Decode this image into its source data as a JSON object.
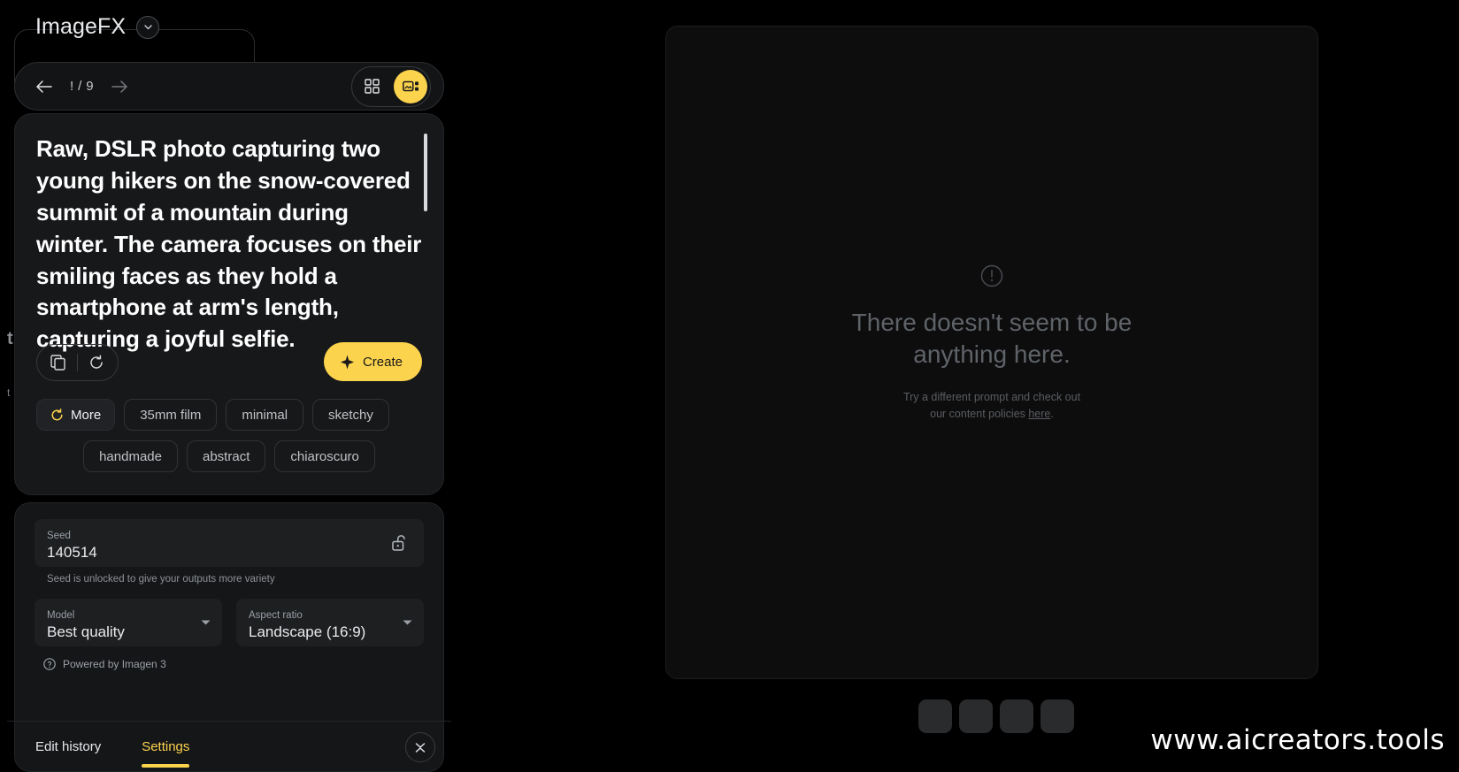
{
  "app": {
    "title": "ImageFX",
    "caret_icon": "chevron-down-icon"
  },
  "nav": {
    "back_icon": "arrow-left-icon",
    "forward_icon": "arrow-right-icon",
    "counter": "! / 9",
    "grid_view_icon": "grid-view-icon",
    "detail_view_icon": "detail-view-icon"
  },
  "prompt": {
    "text": "Raw, DSLR photo capturing two young hikers on the snow-covered summit of a mountain during winter. The camera focuses on their smiling faces as they hold a smartphone at arm's length, capturing a joyful selfie.",
    "copy_icon": "copy-icon",
    "refresh_icon": "refresh-icon",
    "create_label": "Create",
    "create_icon": "sparkle-icon"
  },
  "chips": {
    "more_label": "More",
    "more_icon": "refresh-cw-icon",
    "row1": [
      "35mm film",
      "minimal",
      "sketchy"
    ],
    "row2": [
      "handmade",
      "abstract",
      "chiaroscuro"
    ]
  },
  "settings": {
    "seed": {
      "label": "Seed",
      "value": "140514",
      "lock_icon": "unlock-icon",
      "helper": "Seed is unlocked to give your outputs more variety"
    },
    "model": {
      "label": "Model",
      "value": "Best quality",
      "caret_icon": "chevron-down-icon"
    },
    "aspect_ratio": {
      "label": "Aspect ratio",
      "value": "Landscape (16:9)",
      "caret_icon": "chevron-down-icon"
    },
    "powered_by": "Powered by Imagen 3",
    "powered_icon": "help-circle-icon"
  },
  "tabs": {
    "edit_history": "Edit history",
    "settings": "Settings",
    "active": "Settings",
    "collapse_icon": "collapse-chevrons-icon"
  },
  "ghost": {
    "fragment1": "t",
    "fragment2": "t"
  },
  "empty_state": {
    "icon": "alert-circle-icon",
    "title": "There doesn't seem to be anything here.",
    "sub_line1": "Try a different prompt and check out",
    "sub_line2_prefix": "our content policies ",
    "sub_link": "here",
    "sub_line2_suffix": "."
  },
  "watermark": "www.aicreators.tools",
  "colors": {
    "accent": "#fcd34d",
    "background": "#000000",
    "panel": "#17181a",
    "text_primary": "#ffffff",
    "text_muted": "#9aa0a6"
  }
}
